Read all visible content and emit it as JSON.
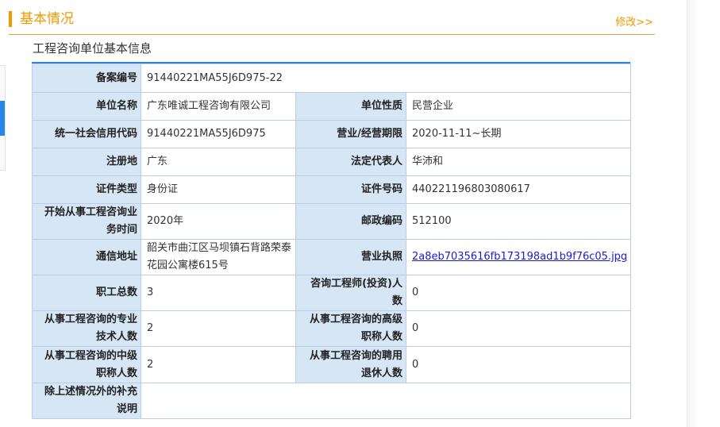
{
  "section": {
    "title": "基本情况",
    "edit_label": "修改>>"
  },
  "subtitle": "工程咨询单位基本信息",
  "info": {
    "record_no": {
      "label": "备案编号",
      "value": "91440221MA55J6D975-22"
    },
    "unit_name": {
      "label": "单位名称",
      "value": "广东唯诚工程咨询有限公司"
    },
    "unit_nature": {
      "label": "单位性质",
      "value": "民营企业"
    },
    "credit_code": {
      "label": "统一社会信用代码",
      "value": "91440221MA55J6D975"
    },
    "business_period": {
      "label": "营业/经营期限",
      "value": "2020-11-11~长期"
    },
    "reg_place": {
      "label": "注册地",
      "value": "广东"
    },
    "legal_rep": {
      "label": "法定代表人",
      "value": "华沛和"
    },
    "id_type": {
      "label": "证件类型",
      "value": "身份证"
    },
    "id_no": {
      "label": "证件号码",
      "value": "440221196803080617"
    },
    "start_time": {
      "label": "开始从事工程咨询业务时间",
      "value": "2020年"
    },
    "postcode": {
      "label": "邮政编码",
      "value": "512100"
    },
    "address": {
      "label": "通信地址",
      "value": "韶关市曲江区马坝镇石背路荣泰花园公寓楼615号"
    },
    "license": {
      "label": "营业执照",
      "value": "2a8eb7035616fb173198ad1b9f76c05.jpg"
    },
    "staff_total": {
      "label": "职工总数",
      "value": "3"
    },
    "consult_engineers": {
      "label": "咨询工程师(投资)人数",
      "value": "0"
    },
    "tech_staff": {
      "label": "从事工程咨询的专业技术人数",
      "value": "2"
    },
    "senior_title": {
      "label": "从事工程咨询的高级职称人数",
      "value": "0"
    },
    "mid_title": {
      "label": "从事工程咨询的中级职称人数",
      "value": "2"
    },
    "retired": {
      "label": "从事工程咨询的聘用退休人数",
      "value": "0"
    },
    "supplement": {
      "label": "除上述情况外的补充说明",
      "value": ""
    }
  }
}
